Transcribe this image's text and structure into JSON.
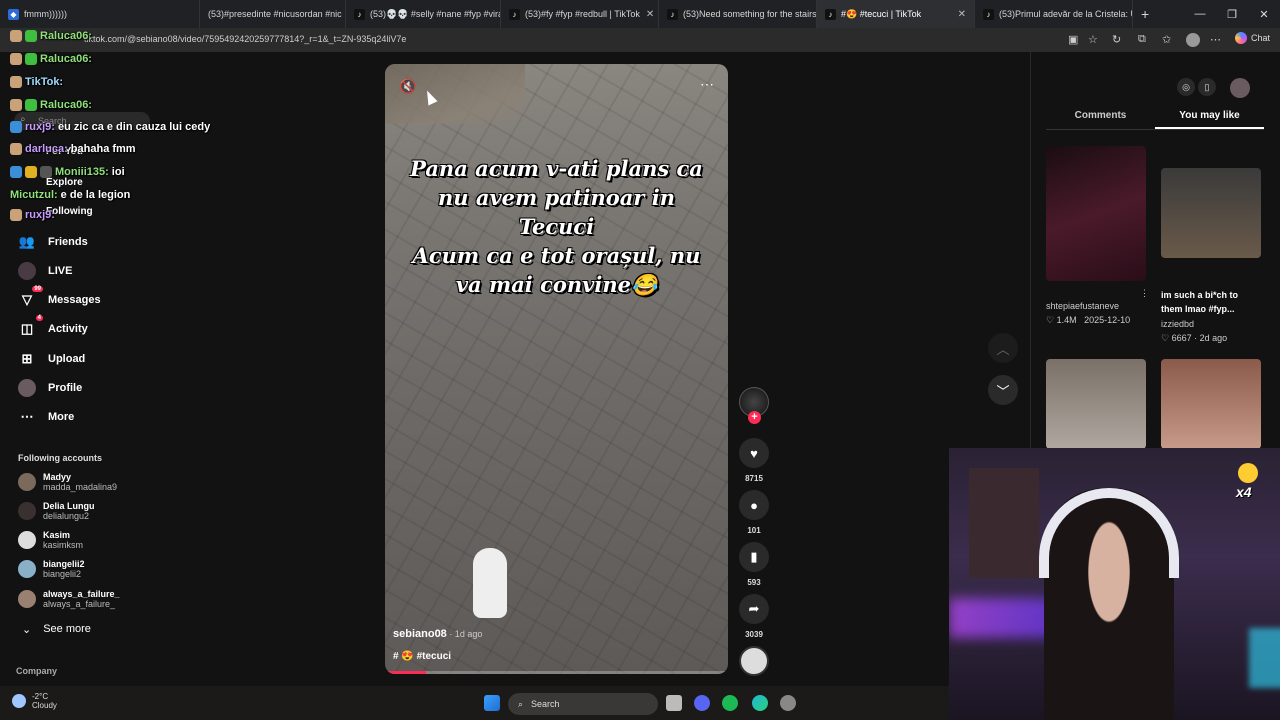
{
  "browser": {
    "tabs": [
      {
        "label": "fmmm))))))",
        "active": false
      },
      {
        "label": "(53)#presedinte #nicusordan #nic",
        "active": false
      },
      {
        "label": "(53)💀💀 #selly #nane #fyp #vira",
        "active": false
      },
      {
        "label": "(53)#fy #fyp #redbull | TikTok",
        "active": false
      },
      {
        "label": "(53)Need something for the stairs",
        "active": false
      },
      {
        "label": "#😍 #tecuci | TikTok",
        "active": true
      },
      {
        "label": "(53)Primul adevăr de la Cristela: U",
        "active": false
      }
    ],
    "new_tab": "+",
    "url": "tiktok.com/@sebiano08/video/7595492420259777814?_r=1&_t=ZN-935q24liV7e",
    "chat_label": "Chat"
  },
  "chat_overlay": [
    {
      "user": "Raluca06:",
      "msg": "",
      "color_class": "u1"
    },
    {
      "user": "Raluca06:",
      "msg": "",
      "color_class": "u1"
    },
    {
      "user": "TikTok:",
      "msg": "",
      "color_class": "u3"
    },
    {
      "user": "Raluca06:",
      "msg": "",
      "color_class": "u1"
    },
    {
      "user": "ruxj9:",
      "msg": "eu zic ca e din cauza lui cedy",
      "color_class": "u2"
    },
    {
      "user": "darluca:",
      "msg": "bahaha fmm",
      "color_class": "u2"
    },
    {
      "user": "Moniii135:",
      "msg": "ioi",
      "color_class": "u1"
    },
    {
      "user": "Micutzul:",
      "msg": "e de la legion",
      "color_class": "u1"
    },
    {
      "user": "ruxj9:",
      "msg": "",
      "color_class": "u2"
    }
  ],
  "left_nav": {
    "search_placeholder": "Search",
    "items": [
      {
        "label": "For You",
        "icon": "home-icon"
      },
      {
        "label": "Explore",
        "icon": "compass-icon"
      },
      {
        "label": "Following",
        "icon": "users-icon"
      },
      {
        "label": "Friends",
        "icon": "friends-icon"
      },
      {
        "label": "LIVE",
        "icon": "live-icon"
      },
      {
        "label": "Messages",
        "icon": "message-icon",
        "badge": "99"
      },
      {
        "label": "Activity",
        "icon": "bell-icon",
        "badge": "4"
      },
      {
        "label": "Upload",
        "icon": "plus-icon"
      },
      {
        "label": "Profile",
        "icon": "profile-icon"
      },
      {
        "label": "More",
        "icon": "more-icon"
      }
    ],
    "following_title": "Following accounts",
    "following": [
      {
        "name": "Madyy",
        "handle": "madda_madalina9"
      },
      {
        "name": "Delia Lungu",
        "handle": "delialungu2"
      },
      {
        "name": "Kasim",
        "handle": "kasimksm"
      },
      {
        "name": "biangelii2",
        "handle": "biangelii2"
      },
      {
        "name": "always_a_failure_",
        "handle": "always_a_failure_"
      }
    ],
    "see_more": "See more",
    "company": "Company"
  },
  "video": {
    "caption": "Pana acum v-ati plans ca\nnu avem patinoar in\nTecuci\nAcum ca e tot orașul, nu\nva mai convine😂",
    "author": "sebiano08",
    "age": " · 1d ago",
    "tags": "# 😍  #tecuci",
    "progress": 0.12
  },
  "actions": {
    "likes": "8715",
    "comments": "101",
    "saves": "593",
    "shares": "3039"
  },
  "right_panel": {
    "tabs": [
      "Comments",
      "You may like"
    ],
    "active_tab": "You may like",
    "items": [
      {
        "user": "shtepiaefustaneve",
        "likes": "1.4M",
        "date": "2025-12-10",
        "title": ""
      },
      {
        "user": "izziedbd",
        "likes": "6667",
        "date": "2d ago",
        "title": "im such a bi*ch to them lmao #fyp..."
      }
    ]
  },
  "stream_overlay": {
    "multiplier": "x4"
  },
  "taskbar": {
    "temp": "-2°C",
    "weather": "Cloudy",
    "search": "Search"
  },
  "colors": {
    "accent": "#fe2c55",
    "bg": "#121212"
  }
}
